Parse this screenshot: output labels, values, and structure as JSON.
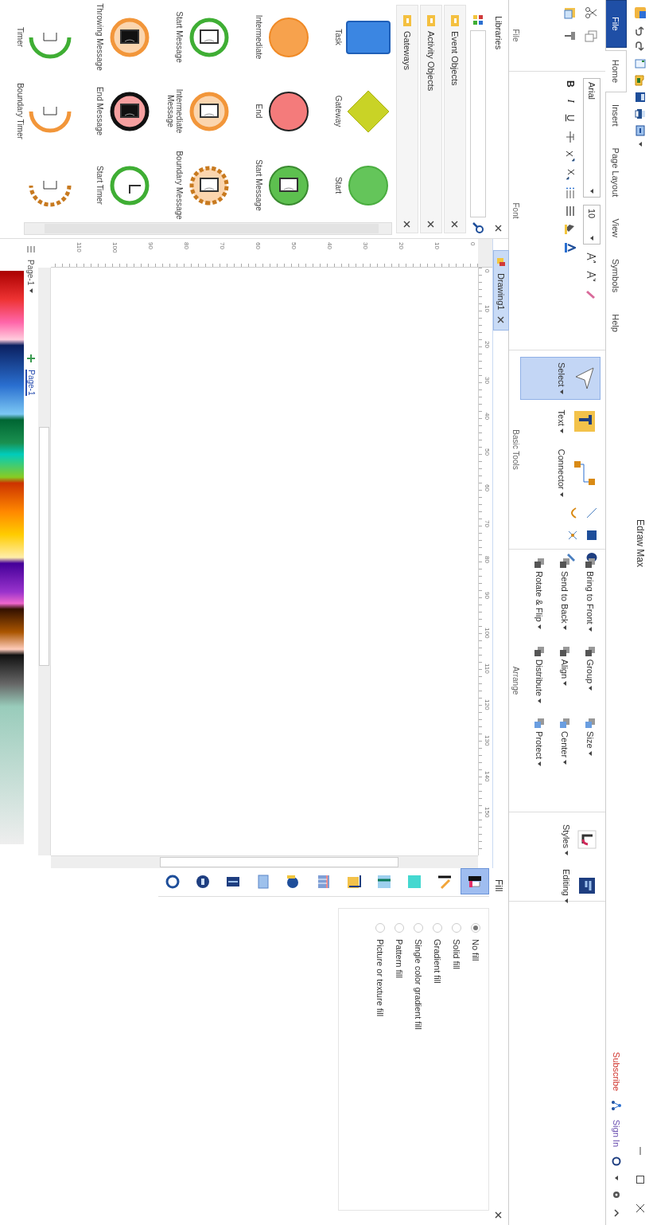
{
  "title_bar": {
    "title": "Edraw Max"
  },
  "tabs": [
    {
      "label": "File",
      "kind": "file",
      "selected": false
    },
    {
      "label": "Home",
      "kind": "tab",
      "selected": true
    },
    {
      "label": "Insert",
      "kind": "tab",
      "selected": false
    },
    {
      "label": "Page Layout",
      "kind": "tab",
      "selected": false
    },
    {
      "label": "View",
      "kind": "tab",
      "selected": false
    },
    {
      "label": "Symbols",
      "kind": "tab",
      "selected": false
    },
    {
      "label": "Help",
      "kind": "tab",
      "selected": false
    }
  ],
  "account": {
    "subscribe": "Subscribe",
    "sign_in": "Sign In"
  },
  "ribbon": [
    {
      "kind": "clipboard",
      "label": "File"
    },
    {
      "kind": "font",
      "label": "Font",
      "font_name": "Arial",
      "font_size": "10",
      "styles": [
        "B",
        "I",
        "U"
      ]
    },
    {
      "kind": "tools",
      "label": "Basic Tools",
      "items": [
        {
          "label": "Select",
          "selected": true
        },
        {
          "label": "Text",
          "selected": false
        },
        {
          "label": "Connector",
          "selected": false
        }
      ]
    },
    {
      "kind": "arrange",
      "label": "Arrange",
      "items": [
        "Bring to Front",
        "Group",
        "Size",
        "Send to Back",
        "Align",
        "Center",
        "Rotate & Flip",
        "Distribute",
        "Protect"
      ]
    },
    {
      "kind": "big",
      "label": "Styles"
    },
    {
      "kind": "big",
      "label": "Editing"
    }
  ],
  "libraries": {
    "title": "Libraries",
    "categories": [
      "Event Objects",
      "Activity Objects",
      "Gateways"
    ],
    "shapes": [
      {
        "kind": "task",
        "label": "Task"
      },
      {
        "kind": "gateway",
        "label": "Gateway"
      },
      {
        "kind": "start",
        "label": "Start"
      },
      {
        "kind": "intermediate",
        "label": "Intermediate"
      },
      {
        "kind": "end",
        "label": "End"
      },
      {
        "kind": "start-message",
        "label": "Start Message"
      },
      {
        "kind": "start-message-ring",
        "label": "Start Message"
      },
      {
        "kind": "intermediate-message",
        "label": "Intermediate Message"
      },
      {
        "kind": "boundary-message",
        "label": "Boundary Message"
      },
      {
        "kind": "throw-message",
        "label": "Throwing Message"
      },
      {
        "kind": "end-message",
        "label": "End Message"
      },
      {
        "kind": "start-timer",
        "label": "Start Timer"
      },
      {
        "kind": "half-green",
        "label": "Timer"
      },
      {
        "kind": "half-orange",
        "label": "Boundary Timer"
      },
      {
        "kind": "half-dashed"
      }
    ]
  },
  "document_tab": {
    "label": "Drawing1"
  },
  "rulers": {
    "horizontal": [
      "0",
      "10",
      "20",
      "30",
      "40",
      "50",
      "60",
      "70",
      "80",
      "90",
      "100",
      "110",
      "120",
      "130",
      "140",
      "150"
    ],
    "vertical": [
      "0",
      "10",
      "20",
      "30",
      "40",
      "50",
      "60",
      "70",
      "80",
      "90",
      "100",
      "110"
    ]
  },
  "page_bar": {
    "page_menu": "Page-1",
    "tabs": [
      {
        "label": "Page-1",
        "selected": true
      }
    ]
  },
  "side_tools": [
    {
      "selected": true
    },
    {
      "selected": false
    },
    {
      "selected": false
    },
    {
      "selected": false
    },
    {
      "selected": false
    },
    {
      "selected": false
    },
    {
      "selected": false
    },
    {
      "selected": false
    },
    {
      "selected": false
    },
    {
      "selected": false
    },
    {
      "selected": false
    }
  ],
  "fill_panel": {
    "title": "Fill",
    "options": [
      {
        "label": "No fill",
        "selected": true
      },
      {
        "label": "Solid fill",
        "selected": false
      },
      {
        "label": "Gradient fill",
        "selected": false
      },
      {
        "label": "Single color gradient fill",
        "selected": false
      },
      {
        "label": "Pattern fill",
        "selected": false
      },
      {
        "label": "Picture or texture fill",
        "selected": false
      }
    ]
  }
}
